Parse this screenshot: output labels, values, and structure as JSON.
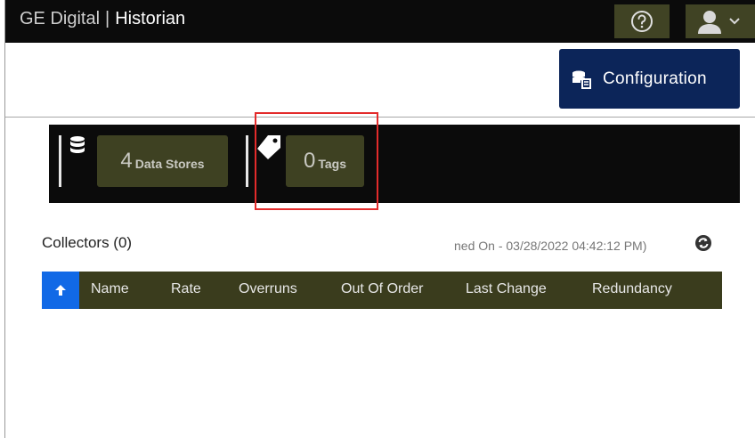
{
  "header": {
    "brand": "GE Digital",
    "separator": "|",
    "app_name": "Historian"
  },
  "toolbar": {
    "help_icon": "help-circle-icon",
    "user_icon": "user-icon",
    "configuration_label": "Configuration"
  },
  "stats": {
    "data_stores": {
      "count": "4",
      "label": "Data Stores",
      "icon": "database-icon"
    },
    "tags": {
      "count": "0",
      "label": "Tags",
      "icon": "tag-icon"
    }
  },
  "collectors": {
    "title": "Collectors (0)",
    "refreshed_text": "ned On - 03/28/2022 04:42:12 PM)",
    "columns": [
      "Name",
      "Rate",
      "Overruns",
      "Out Of Order",
      "Last Change",
      "Redundancy"
    ]
  },
  "colors": {
    "topbar": "#0b0b0b",
    "button_olive": "#404324",
    "config_navy": "#0c2559",
    "sort_blue": "#1169e6",
    "highlight_red": "#e32b2b"
  }
}
